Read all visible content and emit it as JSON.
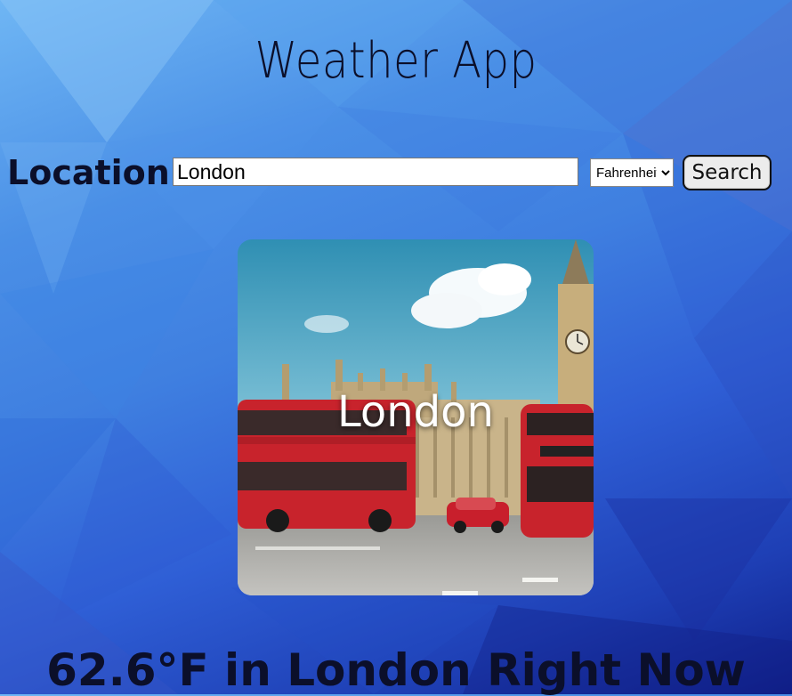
{
  "app": {
    "title": "Weather App"
  },
  "search": {
    "label": "Location:",
    "value": "London",
    "unit_selected": "Fahrenheit",
    "button_label": "Search"
  },
  "city_card": {
    "city_label": "London"
  },
  "current": {
    "heading": "62.6°F in London Right Now"
  }
}
